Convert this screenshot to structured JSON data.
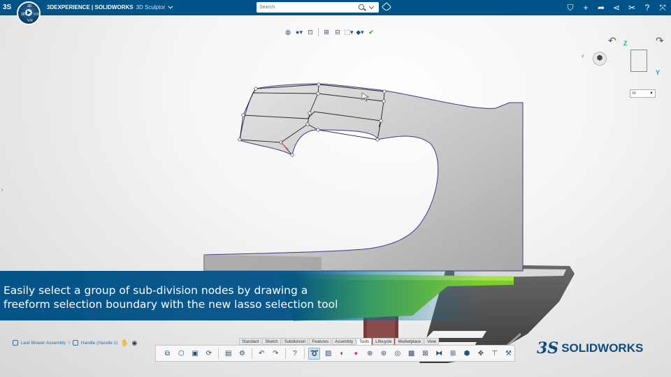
{
  "topbar": {
    "brand_bold": "3DEXPERIENCE | SOLIDWORKS",
    "brand_app": "3D Sculptor",
    "search_placeholder": "Search",
    "compass_labels": {
      "left": "3D",
      "right": "V.R",
      "bottom": "V.R",
      "top": "3D"
    }
  },
  "units": {
    "selected": "in"
  },
  "caption": {
    "line1": "Easily select a group of sub-division nodes by drawing a",
    "line2": "freeform selection boundary with the new lasso selection tool"
  },
  "breadcrumb": {
    "item1": "Leaf Blower Assembly",
    "item2": "Handle (Handle 1)"
  },
  "logo": {
    "ds": "3S",
    "text": "SOLIDWORKS"
  },
  "command_tabs": [
    "Standard",
    "Sketch",
    "Subdivision",
    "Features",
    "Assembly",
    "Tools",
    "Lifecycle",
    "Marketplace",
    "View"
  ],
  "active_tab": "Tools",
  "colors": {
    "topbar": "#005386",
    "caption": "#005187",
    "model_body": "#b9b9b9",
    "accent_green": "#7ccf2a",
    "mesh_edge": "#3a3a8a"
  }
}
